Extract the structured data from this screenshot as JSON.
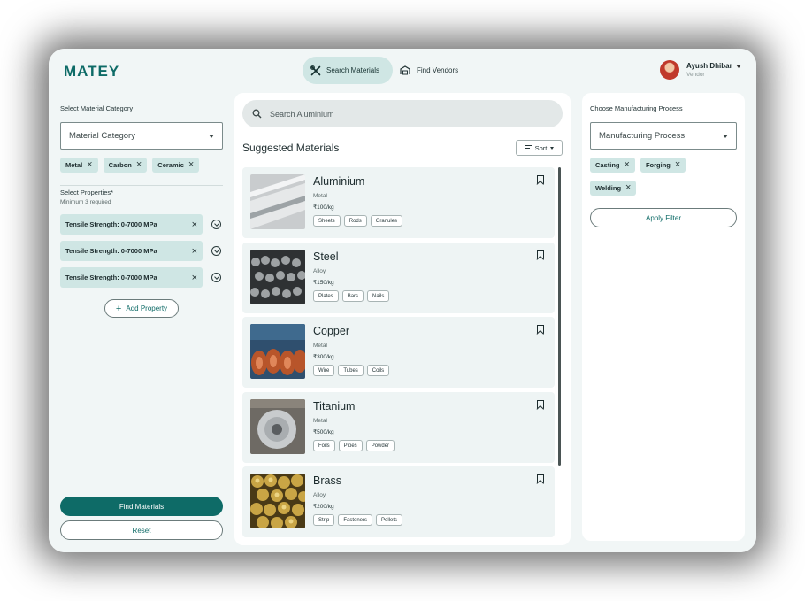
{
  "app": {
    "logo": "MATEY"
  },
  "nav": {
    "search_materials": "Search Materials",
    "find_vendors": "Find Vendors"
  },
  "user": {
    "name": "Ayush Dhibar",
    "role": "Vendor"
  },
  "left": {
    "category_label": "Select Material Category",
    "category_placeholder": "Material Category",
    "category_chips": [
      "Metal",
      "Carbon",
      "Ceramic"
    ],
    "properties_label": "Select Properties*",
    "properties_hint": "Minimum 3 required",
    "properties": [
      "Tensile Strength: 0-7000 MPa",
      "Tensile Strength: 0-7000 MPa",
      "Tensile Strength: 0-7000 MPa"
    ],
    "add_property": "Add Property",
    "find_button": "Find Materials",
    "reset_button": "Reset"
  },
  "center": {
    "search_placeholder": "Search Aluminium",
    "suggested_title": "Suggested Materials",
    "sort_label": "Sort",
    "materials": [
      {
        "name": "Aluminium",
        "type": "Metal",
        "price": "₹100/kg",
        "tags": [
          "Sheets",
          "Rods",
          "Granules"
        ]
      },
      {
        "name": "Steel",
        "type": "Alloy",
        "price": "₹150/kg",
        "tags": [
          "Plates",
          "Bars",
          "Nails"
        ]
      },
      {
        "name": "Copper",
        "type": "Metal",
        "price": "₹300/kg",
        "tags": [
          "Wire",
          "Tubes",
          "Coils"
        ]
      },
      {
        "name": "Titanium",
        "type": "Metal",
        "price": "₹500/kg",
        "tags": [
          "Foils",
          "Pipes",
          "Powder"
        ]
      },
      {
        "name": "Brass",
        "type": "Alloy",
        "price": "₹200/kg",
        "tags": [
          "Strip",
          "Fasteners",
          "Pellets"
        ]
      }
    ]
  },
  "right": {
    "process_label": "Choose Manufacturing Process",
    "process_placeholder": "Manufacturing Process",
    "process_chips": [
      "Casting",
      "Forging",
      "Welding"
    ],
    "apply_button": "Apply Filter"
  },
  "colors": {
    "brand": "#0e6b67",
    "chip": "#cfe6e4",
    "panel_bg": "#f1f6f6"
  },
  "icons": {
    "search_materials": "tools-icon",
    "find_vendors": "warehouse-icon",
    "search": "search-icon",
    "bookmark": "bookmark-icon",
    "remove": "close-icon",
    "expand": "chevron-circle-icon",
    "add": "plus-icon",
    "sort": "sort-icon"
  }
}
